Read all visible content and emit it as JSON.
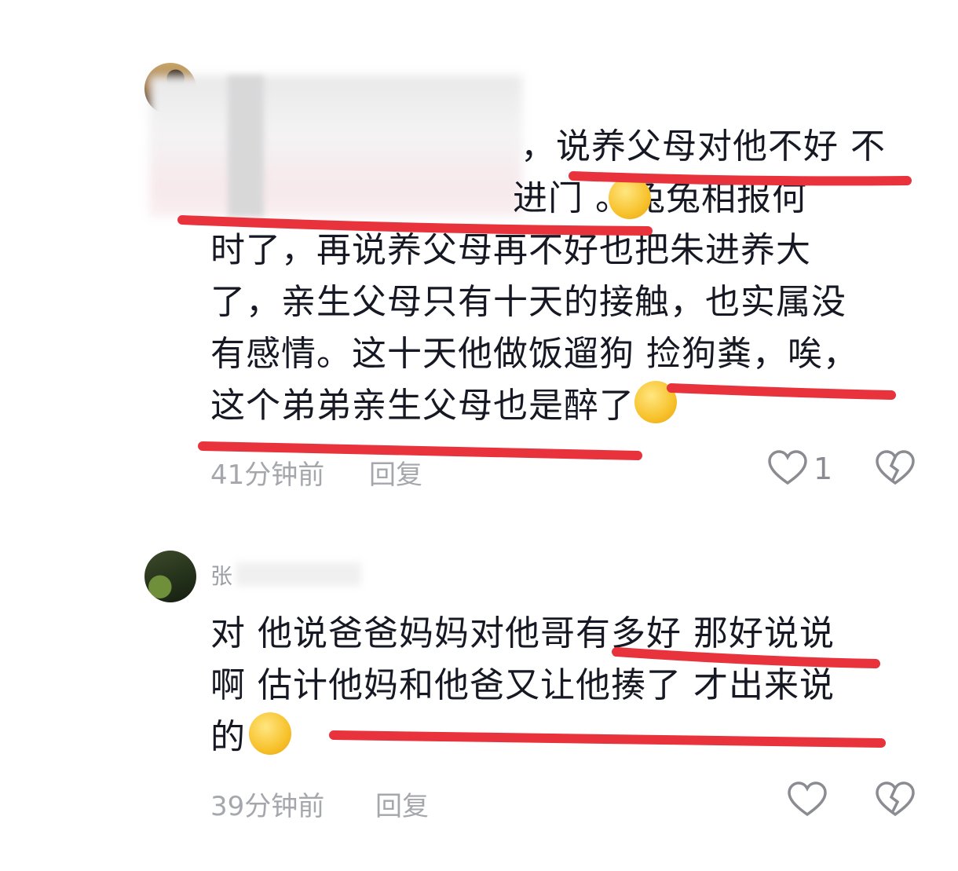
{
  "comments": [
    {
      "username": "",
      "lines": [
        "，说养父母对他不好 不",
        "进门 。兔兔相报何",
        "时了，再说养父母再不好也把朱进养大",
        "了，亲生父母只有十天的接触，也实属没",
        "有感情。这十天他做饭遛狗 捡狗粪，唉，",
        "这个弟弟亲生父母也是醉了"
      ],
      "time": "41分钟前",
      "reply_label": "回复",
      "like_count": "1"
    },
    {
      "username": "张",
      "lines": [
        "对  他说爸爸妈妈对他哥有多好  那好说说",
        "啊  估计他妈和他爸又让他揍了  才出来说",
        "的"
      ],
      "time": "39分钟前",
      "reply_label": "回复",
      "like_count": ""
    }
  ],
  "colors": {
    "accent_red": "#e8323c",
    "text": "#161823",
    "meta": "#a5a7ad"
  },
  "icons": [
    "heart-icon",
    "broken-heart-icon",
    "crying-emoji",
    "laughing-tears-emoji",
    "sweat-smile-emoji"
  ]
}
